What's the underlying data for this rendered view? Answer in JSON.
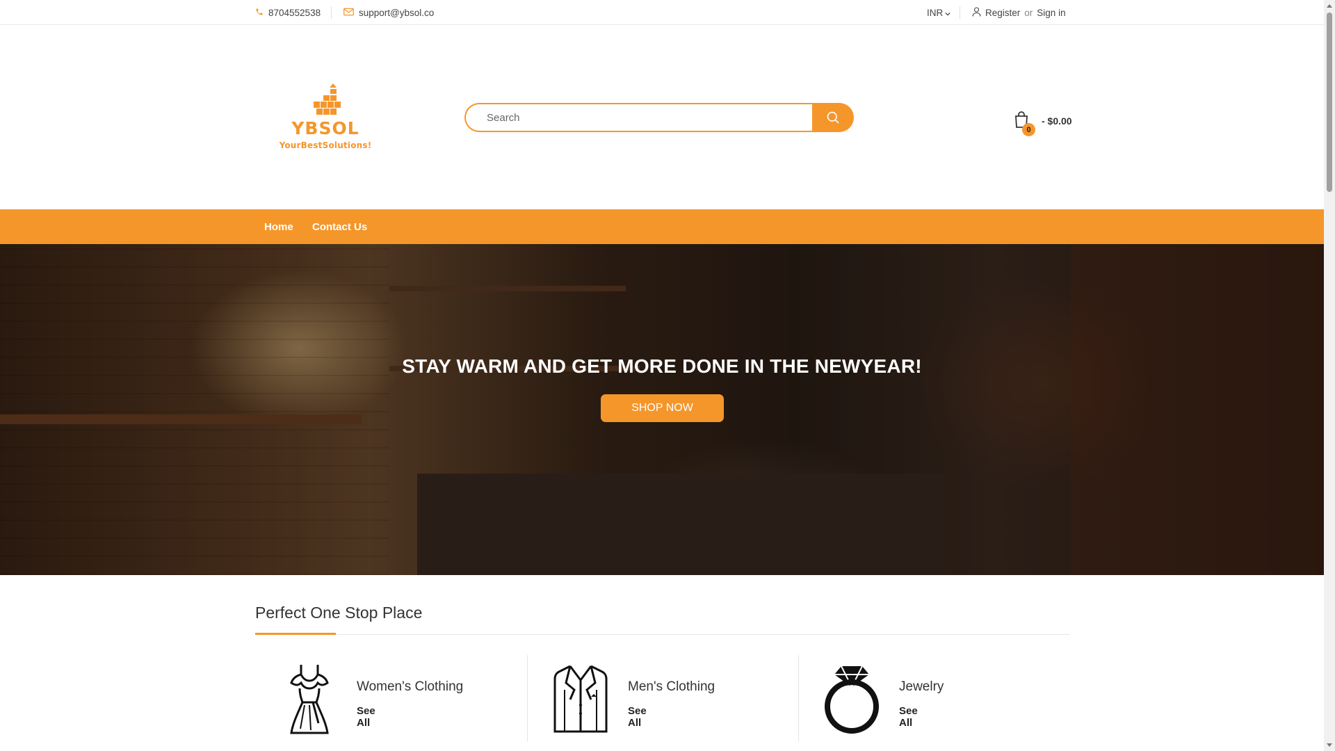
{
  "topbar": {
    "phone": "8704552538",
    "email": "support@ybsol.co",
    "currency": "INR",
    "register": "Register",
    "or": "or",
    "sign_in": "Sign in"
  },
  "header": {
    "logo_brand": "YBSOL",
    "logo_tagline": "YourBestSolutions!",
    "search_placeholder": "Search",
    "cart_count": "0",
    "cart_total": "- $0.00"
  },
  "nav": {
    "items": [
      {
        "label": "Home"
      },
      {
        "label": "Contact Us"
      }
    ]
  },
  "hero": {
    "headline": "STAY WARM AND GET MORE DONE IN THE NEWYEAR!",
    "button": "SHOP NOW"
  },
  "section": {
    "title": "Perfect One Stop Place",
    "categories": [
      {
        "name": "Women's Clothing",
        "link": "See All",
        "icon": "dress-icon"
      },
      {
        "name": "Men's Clothing",
        "link": "See All",
        "icon": "suit-jacket-icon"
      },
      {
        "name": "Jewelry",
        "link": "See All",
        "icon": "diamond-ring-icon"
      }
    ]
  },
  "colors": {
    "accent": "#f5962a",
    "text": "#333333"
  }
}
